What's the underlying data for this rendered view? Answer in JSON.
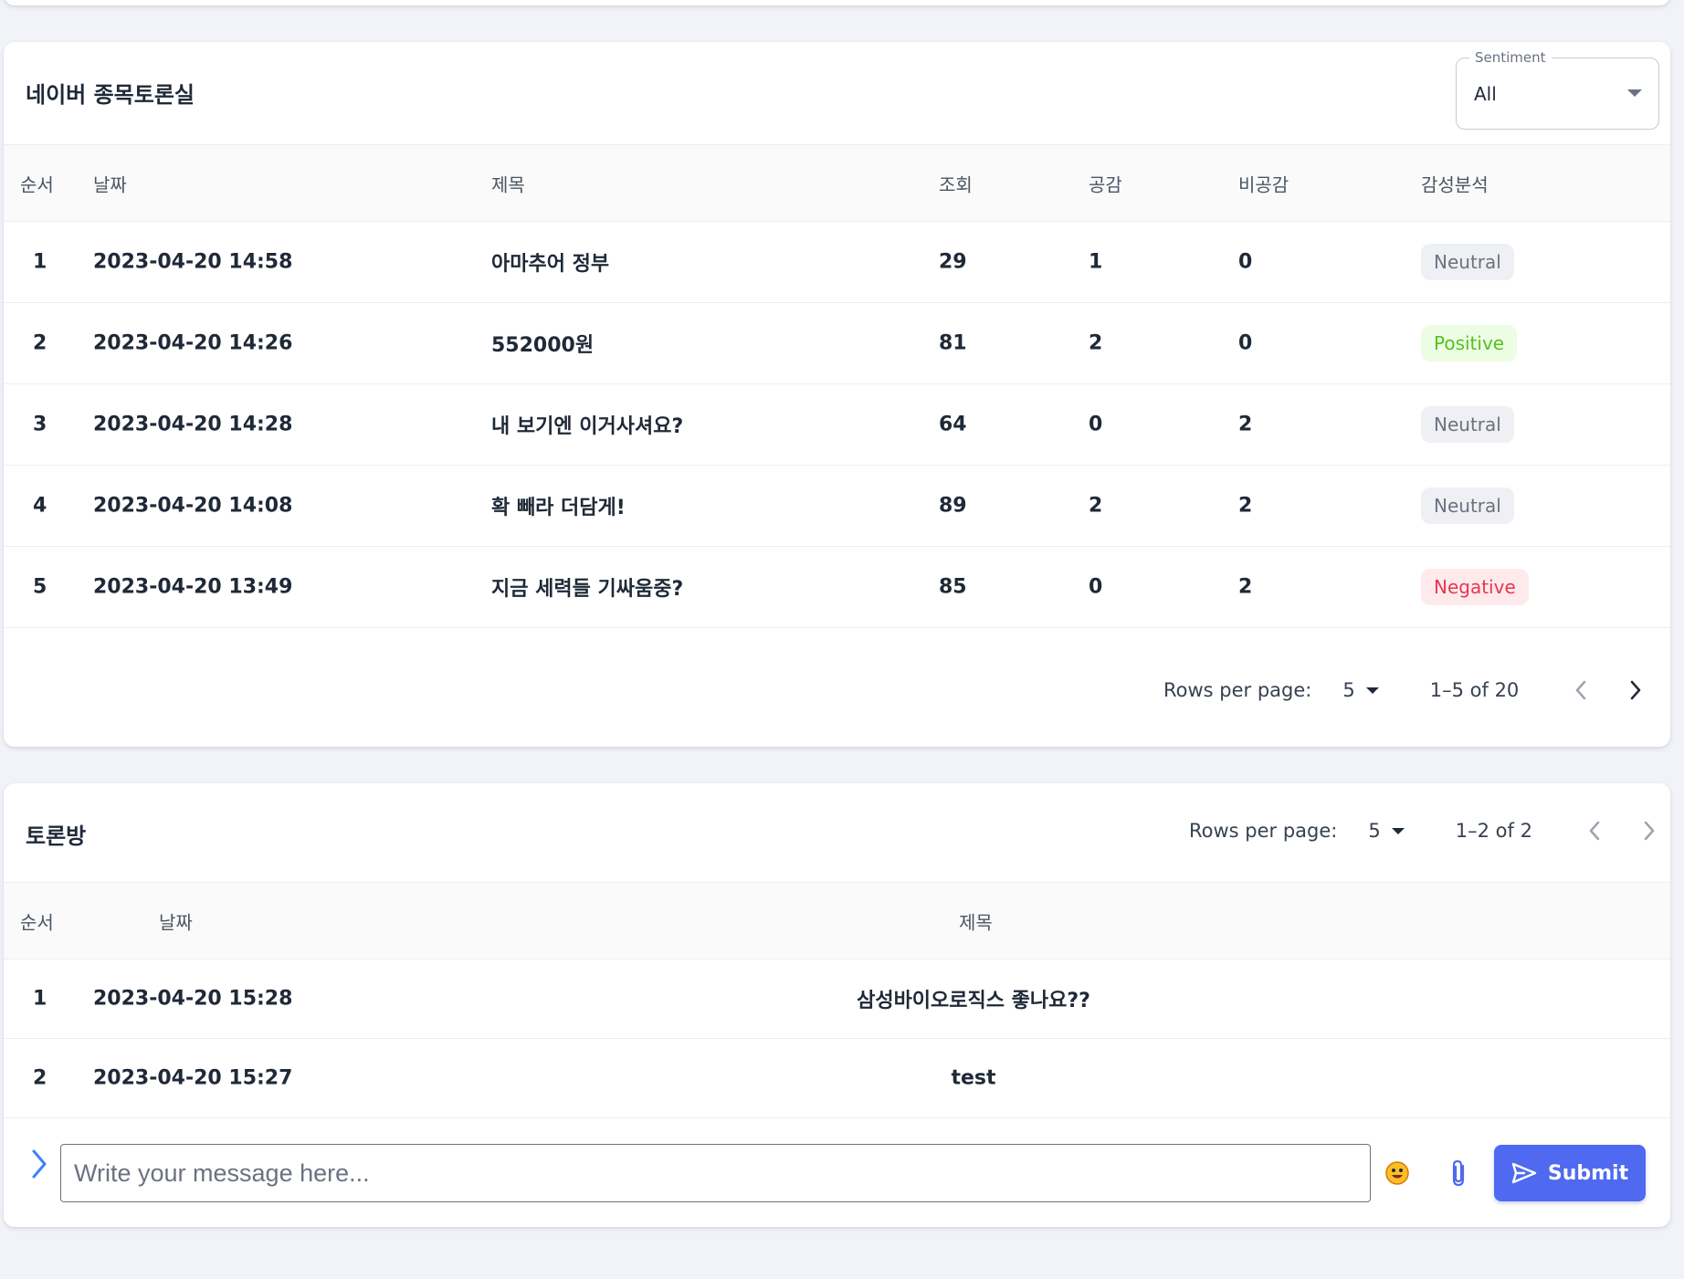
{
  "stock_board": {
    "title": "네이버 종목토론실",
    "sentiment_filter": {
      "label": "Sentiment",
      "value": "All"
    },
    "columns": [
      "순서",
      "날짜",
      "제목",
      "조회",
      "공감",
      "비공감",
      "감성분석"
    ],
    "rows": [
      {
        "no": "1",
        "date": "2023-04-20 14:58",
        "title": "아마추어 정부",
        "views": "29",
        "likes": "1",
        "dislikes": "0",
        "sentiment": "Neutral"
      },
      {
        "no": "2",
        "date": "2023-04-20 14:26",
        "title": "552000원",
        "views": "81",
        "likes": "2",
        "dislikes": "0",
        "sentiment": "Positive"
      },
      {
        "no": "3",
        "date": "2023-04-20 14:28",
        "title": "내 보기엔 이거사셔요?",
        "views": "64",
        "likes": "0",
        "dislikes": "2",
        "sentiment": "Neutral"
      },
      {
        "no": "4",
        "date": "2023-04-20 14:08",
        "title": "확 빼라 더담게!",
        "views": "89",
        "likes": "2",
        "dislikes": "2",
        "sentiment": "Neutral"
      },
      {
        "no": "5",
        "date": "2023-04-20 13:49",
        "title": "지금 세력들 기싸움중?",
        "views": "85",
        "likes": "0",
        "dislikes": "2",
        "sentiment": "Negative"
      }
    ],
    "pagination": {
      "rows_label": "Rows per page:",
      "rows_value": "5",
      "range": "1–5 of 20"
    }
  },
  "discussion": {
    "title": "토론방",
    "columns": [
      "순서",
      "날짜",
      "제목"
    ],
    "rows": [
      {
        "no": "1",
        "date": "2023-04-20 15:28",
        "title": "삼성바이오로직스 좋나요??"
      },
      {
        "no": "2",
        "date": "2023-04-20 15:27",
        "title": "test"
      }
    ],
    "pagination": {
      "rows_label": "Rows per page:",
      "rows_value": "5",
      "range": "1–2 of 2"
    }
  },
  "composer": {
    "placeholder": "Write your message here...",
    "submit_label": "Submit"
  },
  "sentiment_colors": {
    "Neutral": {
      "bg": "#eef0f4",
      "fg": "#6b7280"
    },
    "Positive": {
      "bg": "#edfde4",
      "fg": "#52c41a"
    },
    "Negative": {
      "bg": "#feeaec",
      "fg": "#e8364f"
    }
  }
}
